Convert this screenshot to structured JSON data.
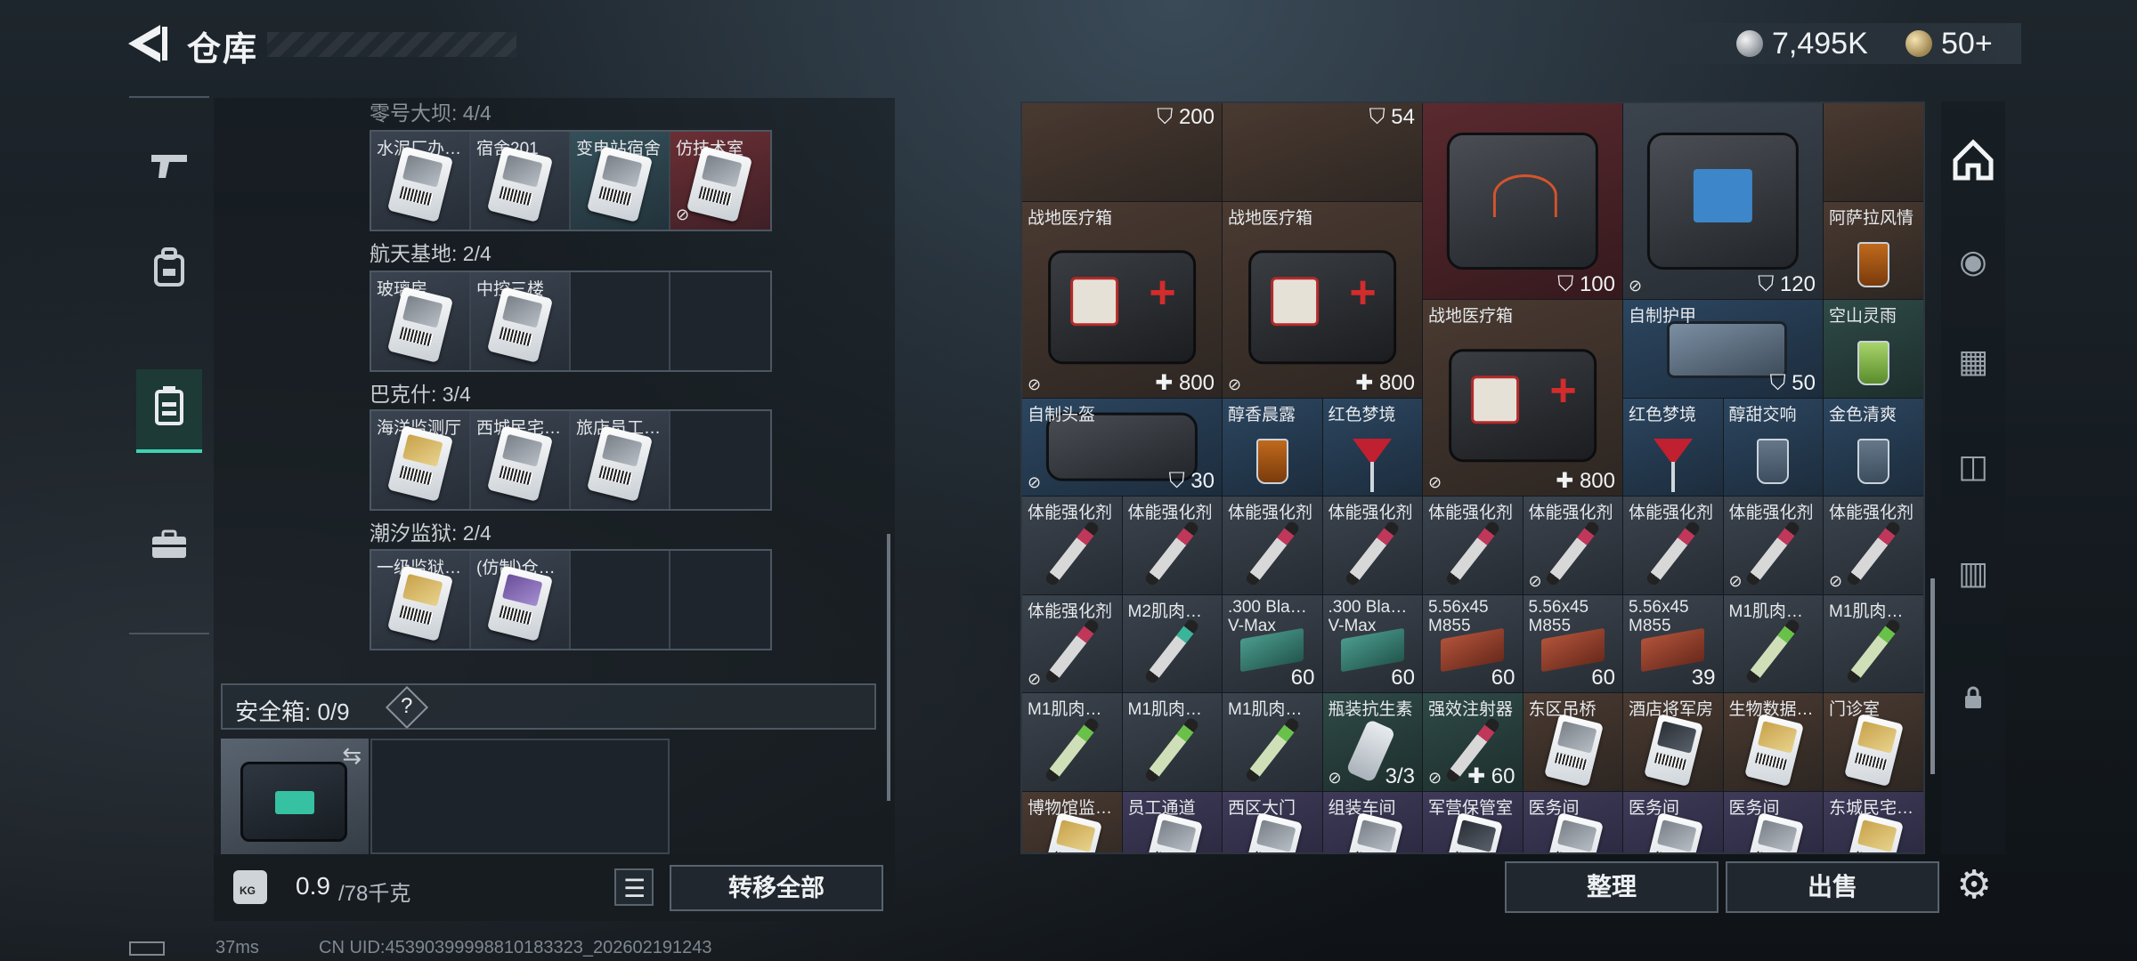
{
  "header": {
    "title": "仓库",
    "currency": "7,495K",
    "tickets": "50+"
  },
  "left_nav": [
    {
      "icon": "gun-icon",
      "glyph": "⌐"
    },
    {
      "icon": "backpack-icon",
      "glyph": "⛑"
    },
    {
      "icon": "storage-icon",
      "glyph": "▤",
      "active": true
    },
    {
      "icon": "briefcase-icon",
      "glyph": "💼"
    }
  ],
  "stash_groups": [
    {
      "label": "零号大坝: 4/4",
      "slots": [
        {
          "name": "水泥厂办…",
          "card": "white"
        },
        {
          "name": "宿舍201",
          "card": "white"
        },
        {
          "name": "变电站宿舍",
          "card": "white"
        },
        {
          "name": "仿技术室",
          "card": "white",
          "red": true,
          "nolock": true
        }
      ]
    },
    {
      "label": "航天基地: 2/4",
      "slots": [
        {
          "name": "玻璃房",
          "card": "white"
        },
        {
          "name": "中控三楼",
          "card": "white"
        },
        {
          "name": "",
          "card": ""
        },
        {
          "name": "",
          "card": ""
        }
      ]
    },
    {
      "label": "巴克什: 3/4",
      "slots": [
        {
          "name": "海洋监测厅",
          "card": "gold"
        },
        {
          "name": "西城民宅…",
          "card": "white"
        },
        {
          "name": "旅店员工…",
          "card": "white"
        },
        {
          "name": "",
          "card": ""
        }
      ]
    },
    {
      "label": "潮汐监狱: 2/4",
      "slots": [
        {
          "name": "一级监狱…",
          "card": "gold"
        },
        {
          "name": "(仿制)仓…",
          "card": "purple"
        },
        {
          "name": "",
          "card": ""
        },
        {
          "name": "",
          "card": ""
        }
      ]
    }
  ],
  "safebox": {
    "label": "安全箱: 0/9",
    "help": "?"
  },
  "weight": {
    "value": "0.9",
    "unit": "/78千克",
    "icon_text": "KG"
  },
  "buttons": {
    "transfer_all": "转移全部",
    "sort": "整理",
    "sell": "出售"
  },
  "status": {
    "ping": "37ms",
    "uid": "CN UID:45390399998810183323_202602191243"
  },
  "grid_items": [
    {
      "row": 0,
      "col": 0,
      "w": 2,
      "h": 1,
      "bg": "brown",
      "name": "",
      "durability": "200",
      "icon": "none"
    },
    {
      "row": 0,
      "col": 2,
      "w": 2,
      "h": 1,
      "bg": "brown",
      "name": "",
      "durability": "54",
      "icon": "none"
    },
    {
      "row": 0,
      "col": 4,
      "w": 2,
      "h": 2,
      "bg": "red",
      "name": "",
      "value": "100",
      "icon": "bag-orange"
    },
    {
      "row": 0,
      "col": 6,
      "w": 2,
      "h": 2,
      "bg": "gray",
      "name": "",
      "value": "120",
      "icon": "bag-screen",
      "nolock": true
    },
    {
      "row": 0,
      "col": 8,
      "w": 1,
      "h": 1,
      "bg": "brown",
      "name": "",
      "icon": "none"
    },
    {
      "row": 1,
      "col": 0,
      "w": 2,
      "h": 2,
      "bg": "brown",
      "name": "战地医疗箱",
      "value": "800",
      "icon": "medkit",
      "nolock": true,
      "plus": true
    },
    {
      "row": 1,
      "col": 2,
      "w": 2,
      "h": 2,
      "bg": "brown",
      "name": "战地医疗箱",
      "value": "800",
      "icon": "medkit",
      "nolock": true,
      "plus": true
    },
    {
      "row": 1,
      "col": 8,
      "w": 1,
      "h": 1,
      "bg": "brown",
      "name": "阿萨拉风情",
      "icon": "glass-amber"
    },
    {
      "row": 2,
      "col": 4,
      "w": 2,
      "h": 2,
      "bg": "brown",
      "name": "战地医疗箱",
      "value": "800",
      "icon": "medkit",
      "nolock": true,
      "plus": true
    },
    {
      "row": 2,
      "col": 6,
      "w": 2,
      "h": 1,
      "bg": "blue",
      "name": "自制护甲",
      "value": "50",
      "icon": "armor"
    },
    {
      "row": 2,
      "col": 8,
      "w": 1,
      "h": 1,
      "bg": "green",
      "name": "空山灵雨",
      "icon": "glass-green"
    },
    {
      "row": 3,
      "col": 0,
      "w": 2,
      "h": 1,
      "bg": "blue",
      "name": "自制头盔",
      "value": "30",
      "icon": "bag",
      "nolock": true
    },
    {
      "row": 3,
      "col": 2,
      "w": 1,
      "h": 1,
      "bg": "blue",
      "name": "醇香晨露",
      "icon": "glass-amber"
    },
    {
      "row": 3,
      "col": 3,
      "w": 1,
      "h": 1,
      "bg": "blue",
      "name": "红色梦境",
      "icon": "martini"
    },
    {
      "row": 3,
      "col": 6,
      "w": 1,
      "h": 1,
      "bg": "blue",
      "name": "红色梦境",
      "icon": "martini"
    },
    {
      "row": 3,
      "col": 7,
      "w": 1,
      "h": 1,
      "bg": "blue",
      "name": "醇甜交响",
      "icon": "glass"
    },
    {
      "row": 3,
      "col": 8,
      "w": 1,
      "h": 1,
      "bg": "blue",
      "name": "金色清爽",
      "icon": "glass"
    },
    {
      "row": 4,
      "col": 0,
      "w": 1,
      "h": 1,
      "bg": "gray",
      "name": "体能强化剂",
      "icon": "syringe"
    },
    {
      "row": 4,
      "col": 1,
      "w": 1,
      "h": 1,
      "bg": "gray",
      "name": "体能强化剂",
      "icon": "syringe"
    },
    {
      "row": 4,
      "col": 2,
      "w": 1,
      "h": 1,
      "bg": "gray",
      "name": "体能强化剂",
      "icon": "syringe"
    },
    {
      "row": 4,
      "col": 3,
      "w": 1,
      "h": 1,
      "bg": "gray",
      "name": "体能强化剂",
      "icon": "syringe"
    },
    {
      "row": 4,
      "col": 4,
      "w": 1,
      "h": 1,
      "bg": "gray",
      "name": "体能强化剂",
      "icon": "syringe"
    },
    {
      "row": 4,
      "col": 5,
      "w": 1,
      "h": 1,
      "bg": "gray",
      "name": "体能强化剂",
      "icon": "syringe",
      "nolock": true
    },
    {
      "row": 4,
      "col": 6,
      "w": 1,
      "h": 1,
      "bg": "gray",
      "name": "体能强化剂",
      "icon": "syringe"
    },
    {
      "row": 4,
      "col": 7,
      "w": 1,
      "h": 1,
      "bg": "gray",
      "name": "体能强化剂",
      "icon": "syringe",
      "nolock": true
    },
    {
      "row": 4,
      "col": 8,
      "w": 1,
      "h": 1,
      "bg": "gray",
      "name": "体能强化剂",
      "icon": "syringe",
      "nolock": true
    },
    {
      "row": 5,
      "col": 0,
      "w": 1,
      "h": 1,
      "bg": "gray",
      "name": "体能强化剂",
      "icon": "syringe",
      "nolock": true
    },
    {
      "row": 5,
      "col": 1,
      "w": 1,
      "h": 1,
      "bg": "gray",
      "name": "M2肌肉…",
      "icon": "syringe-m2"
    },
    {
      "row": 5,
      "col": 2,
      "w": 1,
      "h": 1,
      "bg": "gray",
      "name": ".300 Bla…",
      "sub": "V-Max",
      "value": "60",
      "icon": "ammo-teal"
    },
    {
      "row": 5,
      "col": 3,
      "w": 1,
      "h": 1,
      "bg": "gray",
      "name": ".300 Bla…",
      "sub": "V-Max",
      "value": "60",
      "icon": "ammo-teal"
    },
    {
      "row": 5,
      "col": 4,
      "w": 1,
      "h": 1,
      "bg": "gray",
      "name": "5.56x45",
      "sub": "M855",
      "value": "60",
      "icon": "ammo-rust"
    },
    {
      "row": 5,
      "col": 5,
      "w": 1,
      "h": 1,
      "bg": "gray",
      "name": "5.56x45",
      "sub": "M855",
      "value": "60",
      "icon": "ammo-rust"
    },
    {
      "row": 5,
      "col": 6,
      "w": 1,
      "h": 1,
      "bg": "gray",
      "name": "5.56x45",
      "sub": "M855",
      "value": "39",
      "icon": "ammo-rust"
    },
    {
      "row": 5,
      "col": 7,
      "w": 1,
      "h": 1,
      "bg": "gray",
      "name": "M1肌肉…",
      "icon": "syringe-m1"
    },
    {
      "row": 5,
      "col": 8,
      "w": 1,
      "h": 1,
      "bg": "gray",
      "name": "M1肌肉…",
      "icon": "syringe-m1"
    },
    {
      "row": 6,
      "col": 0,
      "w": 1,
      "h": 1,
      "bg": "gray",
      "name": "M1肌肉…",
      "icon": "syringe-m1"
    },
    {
      "row": 6,
      "col": 1,
      "w": 1,
      "h": 1,
      "bg": "gray",
      "name": "M1肌肉…",
      "icon": "syringe-m1"
    },
    {
      "row": 6,
      "col": 2,
      "w": 1,
      "h": 1,
      "bg": "gray",
      "name": "M1肌肉…",
      "icon": "syringe-m1"
    },
    {
      "row": 6,
      "col": 3,
      "w": 1,
      "h": 1,
      "bg": "green",
      "name": "瓶装抗生素",
      "value": "3/3",
      "icon": "bottle",
      "nolock": true
    },
    {
      "row": 6,
      "col": 4,
      "w": 1,
      "h": 1,
      "bg": "green",
      "name": "强效注射器",
      "value": "60",
      "icon": "syringe",
      "nolock": true,
      "plus": true
    },
    {
      "row": 6,
      "col": 5,
      "w": 1,
      "h": 1,
      "bg": "brown",
      "name": "东区吊桥",
      "icon": "keycard"
    },
    {
      "row": 6,
      "col": 6,
      "w": 1,
      "h": 1,
      "bg": "brown",
      "name": "酒店将军房",
      "icon": "keycard-dark"
    },
    {
      "row": 6,
      "col": 7,
      "w": 1,
      "h": 1,
      "bg": "brown",
      "name": "生物数据…",
      "icon": "keycard-gold"
    },
    {
      "row": 6,
      "col": 8,
      "w": 1,
      "h": 1,
      "bg": "brown",
      "name": "门诊室",
      "icon": "keycard-gold"
    },
    {
      "row": 7,
      "col": 0,
      "w": 1,
      "h": 1,
      "bg": "brown",
      "name": "博物馆监…",
      "icon": "keycard-gold"
    },
    {
      "row": 7,
      "col": 1,
      "w": 1,
      "h": 1,
      "bg": "purple",
      "name": "员工通道",
      "icon": "keycard"
    },
    {
      "row": 7,
      "col": 2,
      "w": 1,
      "h": 1,
      "bg": "purple",
      "name": "西区大门",
      "icon": "keycard"
    },
    {
      "row": 7,
      "col": 3,
      "w": 1,
      "h": 1,
      "bg": "purple",
      "name": "组装车间",
      "icon": "keycard"
    },
    {
      "row": 7,
      "col": 4,
      "w": 1,
      "h": 1,
      "bg": "purple",
      "name": "军营保管室",
      "icon": "keycard-dark"
    },
    {
      "row": 7,
      "col": 5,
      "w": 1,
      "h": 1,
      "bg": "purple",
      "name": "医务间",
      "icon": "keycard"
    },
    {
      "row": 7,
      "col": 6,
      "w": 1,
      "h": 1,
      "bg": "purple",
      "name": "医务间",
      "icon": "keycard"
    },
    {
      "row": 7,
      "col": 7,
      "w": 1,
      "h": 1,
      "bg": "purple",
      "name": "医务间",
      "icon": "keycard"
    },
    {
      "row": 7,
      "col": 8,
      "w": 1,
      "h": 1,
      "bg": "purple",
      "name": "东城民宅…",
      "icon": "keycard-gold"
    }
  ],
  "right_rail": [
    {
      "icon": "home-icon",
      "glyph": "⌂",
      "active": true
    },
    {
      "icon": "camera-settings-icon",
      "glyph": "◉"
    },
    {
      "icon": "folder-icon",
      "glyph": "▦"
    },
    {
      "icon": "folder-camera-icon",
      "glyph": "◫"
    },
    {
      "icon": "folder-list-icon",
      "glyph": "▥"
    },
    {
      "icon": "lock-icon",
      "glyph": "🔒"
    }
  ]
}
